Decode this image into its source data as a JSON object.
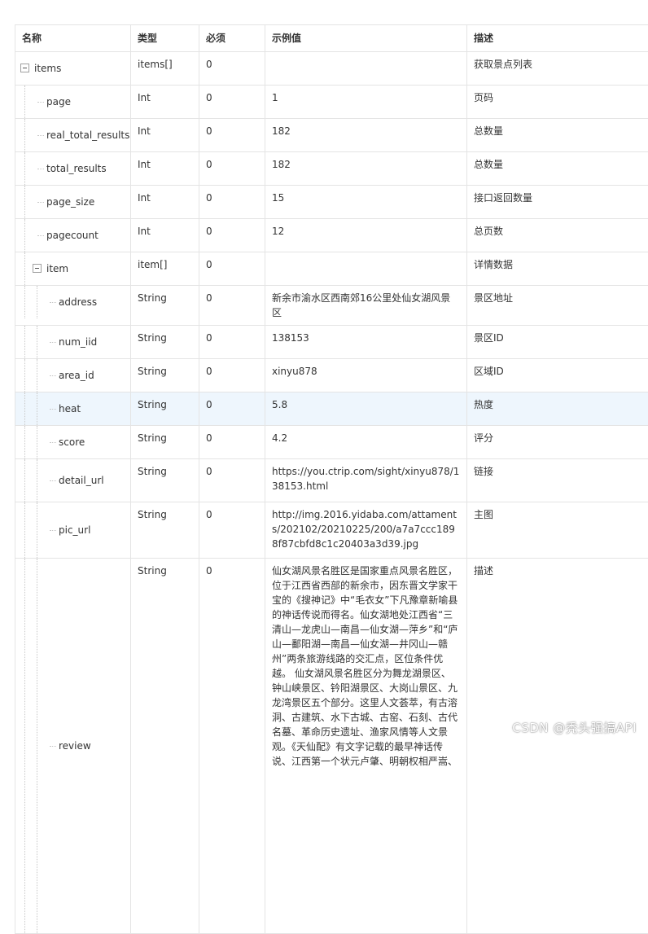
{
  "headers": {
    "name": "名称",
    "type": "类型",
    "required": "必须",
    "example": "示例值",
    "desc": "描述"
  },
  "rows": [
    {
      "name": "items",
      "type": "items[]",
      "required": "0",
      "example": "",
      "desc": "获取景点列表"
    },
    {
      "name": "page",
      "type": "Int",
      "required": "0",
      "example": "1",
      "desc": "页码"
    },
    {
      "name": "real_total_results",
      "type": "Int",
      "required": "0",
      "example": "182",
      "desc": "总数量"
    },
    {
      "name": "total_results",
      "type": "Int",
      "required": "0",
      "example": "182",
      "desc": "总数量"
    },
    {
      "name": "page_size",
      "type": "Int",
      "required": "0",
      "example": "15",
      "desc": "接口返回数量"
    },
    {
      "name": "pagecount",
      "type": "Int",
      "required": "0",
      "example": "12",
      "desc": "总页数"
    },
    {
      "name": "item",
      "type": "item[]",
      "required": "0",
      "example": "",
      "desc": "详情数据"
    },
    {
      "name": "address",
      "type": "String",
      "required": "0",
      "example": "新余市渝水区西南郊16公里处仙女湖风景区",
      "desc": "景区地址"
    },
    {
      "name": "num_iid",
      "type": "String",
      "required": "0",
      "example": "138153",
      "desc": "景区ID"
    },
    {
      "name": "area_id",
      "type": "String",
      "required": "0",
      "example": "xinyu878",
      "desc": "区域ID"
    },
    {
      "name": "heat",
      "type": "String",
      "required": "0",
      "example": "5.8",
      "desc": "热度"
    },
    {
      "name": "score",
      "type": "String",
      "required": "0",
      "example": "4.2",
      "desc": "评分"
    },
    {
      "name": "detail_url",
      "type": "String",
      "required": "0",
      "example": "https://you.ctrip.com/sight/xinyu878/138153.html",
      "desc": "链接"
    },
    {
      "name": "pic_url",
      "type": "String",
      "required": "0",
      "example": "http://img.2016.yidaba.com/attaments/202102/20210225/200/a7a7ccc1898f87cbfd8c1c20403a3d39.jpg",
      "desc": "主图"
    },
    {
      "name": "review",
      "type": "String",
      "required": "0",
      "example": "仙女湖风景名胜区是国家重点风景名胜区，位于江西省西部的新余市，因东晋文学家干宝的《搜神记》中“毛衣女”下凡豫章新喻县的神话传说而得名。仙女湖地处江西省“三清山—龙虎山—南昌—仙女湖—萍乡”和“庐山—鄱阳湖—南昌—仙女湖—井冈山—赣州”两条旅游线路的交汇点，区位条件优越。 仙女湖风景名胜区分为舞龙湖景区、钟山峡景区、钤阳湖景区、大岗山景区、九龙湾景区五个部分。这里人文荟萃，有古溶洞、古建筑、水下古城、古窑、石刻、古代名墓、革命历史遗址、渔家风情等人文景观。《天仙配》有文字记载的最早神话传说、江西第一个状元卢肇、明朝权相严嵩、",
      "desc": "描述"
    }
  ],
  "watermark": "CSDN @秃头强搞API"
}
